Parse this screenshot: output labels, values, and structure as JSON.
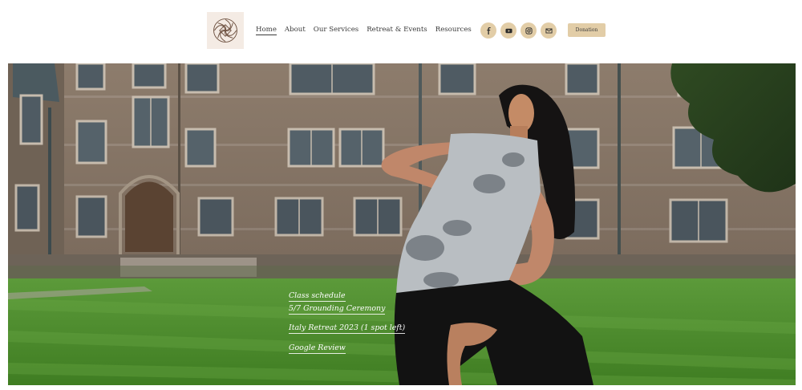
{
  "brand": {
    "accent": "#e2cda7",
    "logo_bg": "#f4ebe4"
  },
  "nav": {
    "items": [
      {
        "label": "Home"
      },
      {
        "label": "About"
      },
      {
        "label": "Our Services"
      },
      {
        "label": "Retreat & Events"
      },
      {
        "label": "Resources"
      }
    ],
    "active": "Home"
  },
  "socials": [
    {
      "icon": "facebook-icon"
    },
    {
      "icon": "youtube-icon"
    },
    {
      "icon": "instagram-icon"
    },
    {
      "icon": "email-icon"
    }
  ],
  "donate": {
    "label": "Donation"
  },
  "hero": {
    "links": [
      {
        "label": "Class schedule"
      },
      {
        "label": "5/7 Grounding Ceremony"
      },
      {
        "label": "Italy Retreat 2023 (1 spot left)"
      },
      {
        "label": "Google Review"
      }
    ]
  }
}
